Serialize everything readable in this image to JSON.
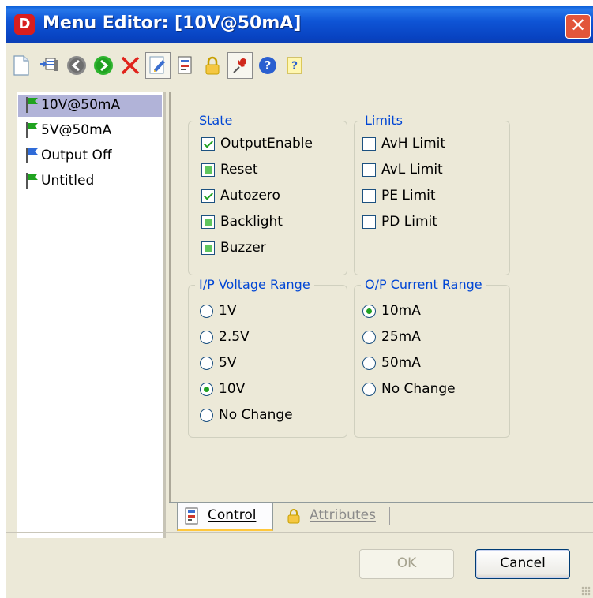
{
  "window": {
    "title": "Menu Editor: [10V@50mA]",
    "app_icon_letter": "D"
  },
  "toolbar": {
    "buttons": [
      {
        "name": "new-icon"
      },
      {
        "name": "import-icon"
      },
      {
        "name": "back-icon"
      },
      {
        "name": "forward-icon"
      },
      {
        "name": "delete-icon"
      },
      {
        "name": "edit-icon",
        "pressed": true
      },
      {
        "name": "properties-icon"
      },
      {
        "name": "lock-icon"
      },
      {
        "name": "pin-icon",
        "pressed": true
      },
      {
        "name": "help-icon"
      },
      {
        "name": "context-help-icon"
      }
    ]
  },
  "tree": {
    "items": [
      {
        "label": "10V@50mA",
        "flag_color": "#1fa31f",
        "selected": true
      },
      {
        "label": "5V@50mA",
        "flag_color": "#1fa31f"
      },
      {
        "label": "Output Off",
        "flag_color": "#2f6bd8"
      },
      {
        "label": "Untitled",
        "flag_color": "#1fa31f"
      }
    ]
  },
  "state": {
    "legend": "State",
    "items": [
      {
        "label": "OutputEnable",
        "state": "checked"
      },
      {
        "label": "Reset",
        "state": "indeterminate"
      },
      {
        "label": "Autozero",
        "state": "checked"
      },
      {
        "label": "Backlight",
        "state": "indeterminate"
      },
      {
        "label": "Buzzer",
        "state": "indeterminate"
      }
    ]
  },
  "limits": {
    "legend": "Limits",
    "items": [
      {
        "label": "AvH Limit",
        "state": "unchecked"
      },
      {
        "label": "AvL Limit",
        "state": "unchecked"
      },
      {
        "label": "PE Limit",
        "state": "unchecked"
      },
      {
        "label": "PD Limit",
        "state": "unchecked"
      }
    ]
  },
  "ip_range": {
    "legend": "I/P Voltage Range",
    "options": [
      "1V",
      "2.5V",
      "5V",
      "10V",
      "No Change"
    ],
    "selected": "10V"
  },
  "op_range": {
    "legend": "O/P Current Range",
    "options": [
      "10mA",
      "25mA",
      "50mA",
      "No Change"
    ],
    "selected": "10mA"
  },
  "tabs": [
    {
      "label": "Control",
      "active": true
    },
    {
      "label": "Attributes",
      "active": false
    }
  ],
  "buttons": {
    "ok": "OK",
    "cancel": "Cancel"
  },
  "colors": {
    "titlebar": "#0a4fd0",
    "legend_text": "#0046d5",
    "check_green": "#21a121",
    "selection": "#b1b3d8"
  }
}
